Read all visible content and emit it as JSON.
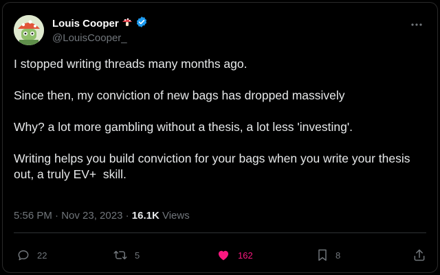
{
  "author": {
    "display_name": "Louis Cooper",
    "emoji_badge": "mushroom-icon",
    "verified_badge": "verified-icon",
    "handle": "@LouisCooper_"
  },
  "tweet": {
    "paragraphs": [
      "I stopped writing threads many months ago.",
      "Since then, my conviction of new bags has dropped massively",
      "Why? a lot more gambling without a thesis, a lot less 'investing'.",
      "Writing helps you build conviction for your bags when you write your thesis out, a truly EV+  skill."
    ],
    "timestamp": "5:56 PM · Nov 23, 2023 · ",
    "views_count": "16.1K",
    "views_label": " Views"
  },
  "actions": {
    "replies": "22",
    "reposts": "5",
    "likes": "162",
    "bookmarks": "8"
  },
  "colors": {
    "background": "#000000",
    "text": "#e7e9ea",
    "muted": "#71767b",
    "like_pink": "#f91880",
    "verified_blue": "#1d9bf0"
  }
}
